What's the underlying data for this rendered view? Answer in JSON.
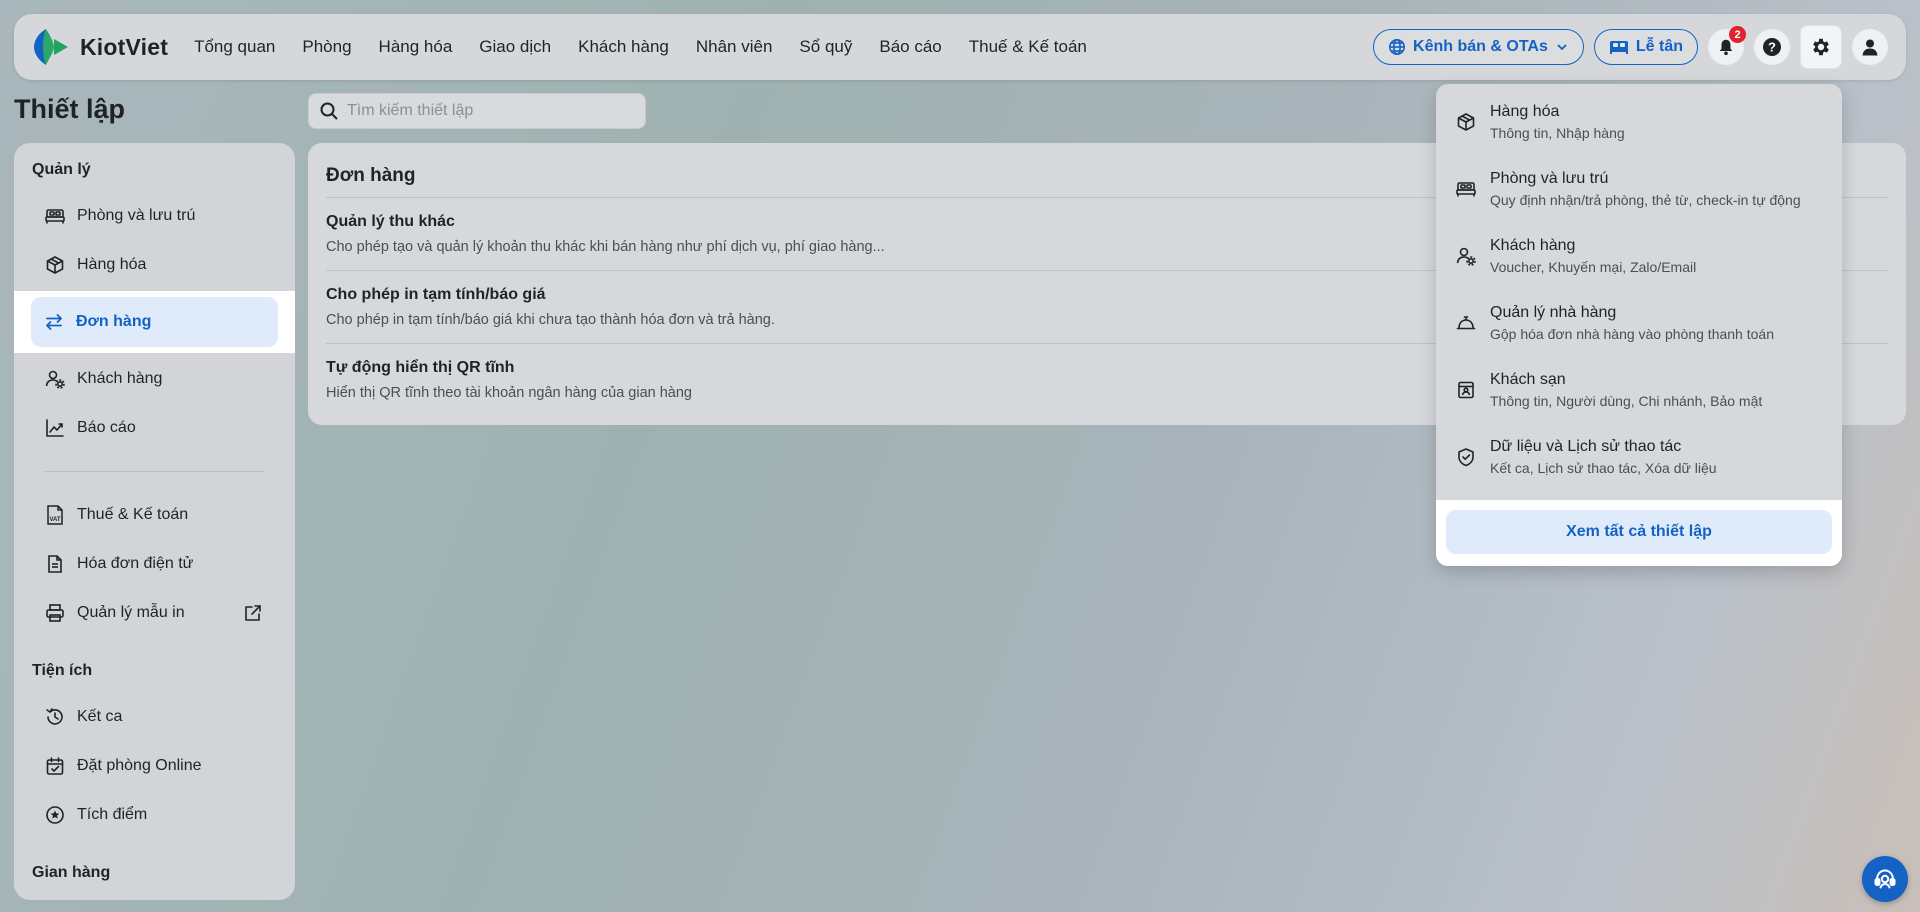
{
  "brand": {
    "name": "KiotViet"
  },
  "nav": {
    "items": [
      "Tổng quan",
      "Phòng",
      "Hàng hóa",
      "Giao dịch",
      "Khách hàng",
      "Nhân viên",
      "Sổ quỹ",
      "Báo cáo",
      "Thuế & Kế toán"
    ]
  },
  "topbar": {
    "channels_label": "Kênh bán & OTAs",
    "reception_label": "Lễ tân",
    "notification_count": "2"
  },
  "page": {
    "title": "Thiết lập",
    "search_placeholder": "Tìm kiếm thiết lập"
  },
  "sidebar": {
    "section_manage": "Quản lý",
    "items_manage": [
      {
        "label": "Phòng và lưu trú",
        "icon": "bed-icon"
      },
      {
        "label": "Hàng hóa",
        "icon": "box-icon"
      },
      {
        "label": "Đơn hàng",
        "icon": "swap-icon",
        "active": true
      },
      {
        "label": "Khách hàng",
        "icon": "user-settings-icon"
      },
      {
        "label": "Báo cáo",
        "icon": "chart-icon"
      }
    ],
    "items_tax": [
      {
        "label": "Thuế & Kế toán",
        "icon": "vat-icon"
      },
      {
        "label": "Hóa đơn điện tử",
        "icon": "invoice-icon"
      },
      {
        "label": "Quản lý mẫu in",
        "icon": "printer-icon"
      }
    ],
    "section_utilities": "Tiện ích",
    "items_utilities": [
      {
        "label": "Kết ca",
        "icon": "history-icon"
      },
      {
        "label": "Đặt phòng Online",
        "icon": "calendar-icon"
      },
      {
        "label": "Tích điểm",
        "icon": "star-icon"
      }
    ],
    "section_store": "Gian hàng"
  },
  "main": {
    "title": "Đơn hàng",
    "settings": [
      {
        "title": "Quản lý thu khác",
        "desc": "Cho phép tạo và quản lý khoản thu khác khi bán hàng như phí dịch vụ, phí giao hàng..."
      },
      {
        "title": "Cho phép in tạm tính/báo giá",
        "desc": "Cho phép in tạm tính/báo giá khi chưa tạo thành hóa đơn và trả hàng."
      },
      {
        "title": "Tự động hiển thị QR tĩnh",
        "desc": "Hiển thị QR tĩnh theo tài khoản ngân hàng của gian hàng"
      }
    ]
  },
  "dropdown": {
    "items": [
      {
        "title": "Hàng hóa",
        "desc": "Thông tin, Nhập hàng"
      },
      {
        "title": "Phòng và lưu trú",
        "desc": "Quy định nhận/trả phòng, thẻ từ, check-in tự động"
      },
      {
        "title": "Khách hàng",
        "desc": "Voucher, Khuyến mại, Zalo/Email"
      },
      {
        "title": "Quản lý nhà hàng",
        "desc": "Gộp hóa đơn nhà hàng vào phòng thanh toán"
      },
      {
        "title": "Khách sạn",
        "desc": "Thông tin, Người dùng, Chi nhánh, Bảo mật"
      },
      {
        "title": "Dữ liệu và Lịch sử thao tác",
        "desc": "Kết ca, Lịch sử thao tác, Xóa dữ liệu"
      }
    ],
    "view_all_label": "Xem tất cả thiết lập"
  },
  "colors": {
    "accent": "#1463c4",
    "active_bg": "#dfebfa",
    "badge": "#e0242f"
  }
}
